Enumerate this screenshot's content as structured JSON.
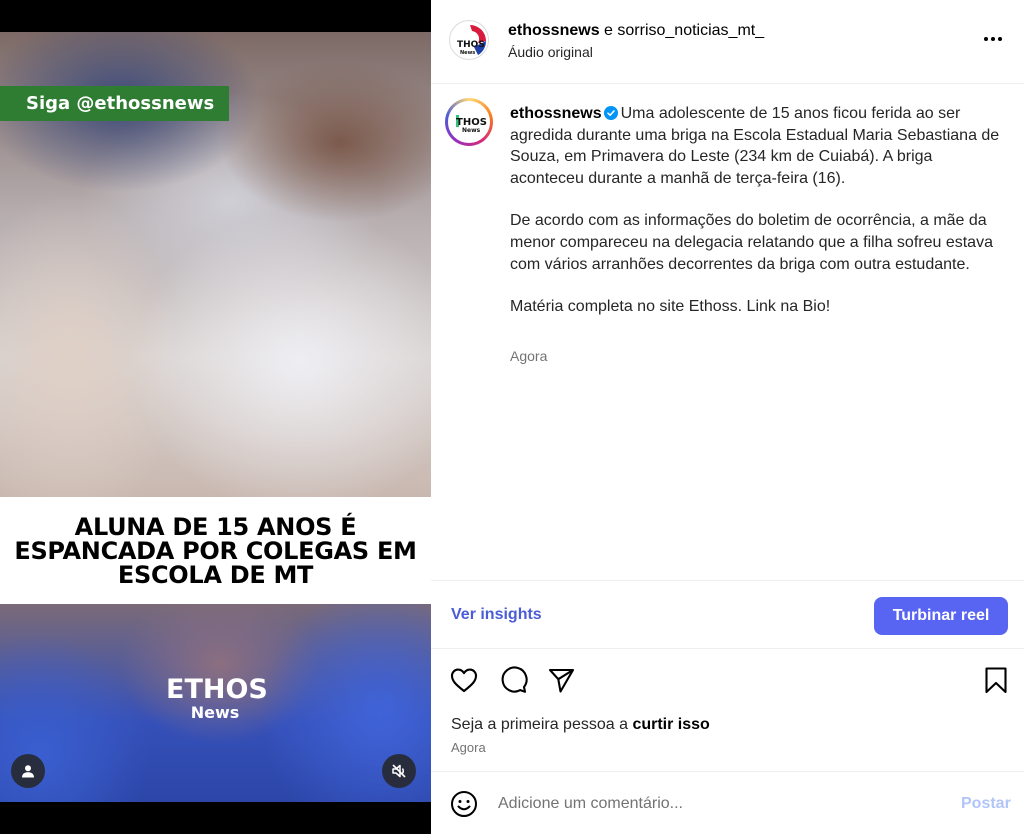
{
  "reel": {
    "follow_tag": "Siga @ethossnews",
    "headline": "ALUNA DE 15 ANOS É ESPANCADA POR COLEGAS EM ESCOLA DE MT",
    "logo_mark": "ETHOS",
    "logo_sub": "News",
    "profile_button_icon": "user-icon",
    "mute_button_icon": "speaker-muted-icon",
    "colors": {
      "tag_bg": "#2e7d32",
      "headline_bg": "#ffffff"
    }
  },
  "header": {
    "user1": "ethossnews",
    "joiner": " e ",
    "user2": "sorriso_noticias_mt_",
    "audio": "Áudio original",
    "more_icon": "more-horizontal-icon",
    "avatar_text": "ETHOS",
    "avatar_sub": "News"
  },
  "caption": {
    "username": "ethossnews",
    "paragraph1": "Uma adolescente de 15 anos ficou ferida ao ser agredida durante uma briga na Escola Estadual Maria Sebastiana de Souza, em Primavera do Leste (234 km de Cuiabá). A briga aconteceu durante a manhã de terça-feira (16).",
    "paragraph2": "De acordo com as informações do boletim de ocorrência, a mãe da menor compareceu na delegacia relatando que a filha sofreu estava com vários arranhões decorrentes da briga com outra estudante.",
    "paragraph3": "Matéria completa no site Ethoss. Link na Bio!",
    "time": "Agora",
    "avatar_text": "ETHOS",
    "avatar_sub": "News"
  },
  "insights": {
    "link_label": "Ver insights",
    "boost_label": "Turbinar reel",
    "colors": {
      "link": "#4a5dd6",
      "button": "#5865f2"
    }
  },
  "actions": {
    "like_icon": "heart-icon",
    "comment_icon": "comment-icon",
    "share_icon": "send-icon",
    "save_icon": "bookmark-icon",
    "likes_prefix": "Seja a primeira pessoa a ",
    "likes_action": "curtir isso",
    "time": "Agora"
  },
  "comment": {
    "placeholder": "Adicione um comentário...",
    "post_label": "Postar",
    "emoji_icon": "emoji-icon"
  }
}
